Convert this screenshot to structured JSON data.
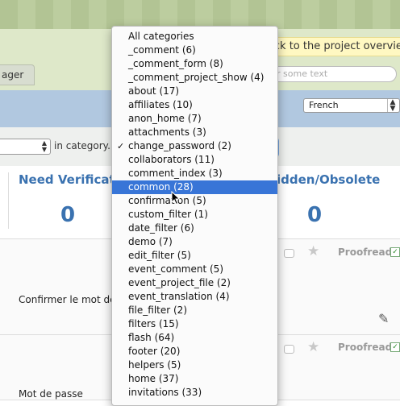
{
  "header": {
    "tab_label": "ager",
    "back_link": "Back to the project overview",
    "search_placeholder": "r some text"
  },
  "toolbar": {
    "language": "French",
    "in_category_label": "in category..."
  },
  "stats": {
    "need_verification_title": "Need Verification",
    "need_verification_count": "0",
    "hidden_title": "idden/Obsolete",
    "hidden_count": "0"
  },
  "rows": [
    {
      "text": "Confirmer le mot de",
      "status": "Proofread"
    },
    {
      "text": "Mot de passe",
      "status": "Proofread"
    }
  ],
  "category_dropdown": {
    "items": [
      "All categories",
      "_comment (6)",
      "_comment_form (8)",
      "_comment_project_show (4)",
      "about (17)",
      "affiliates (10)",
      "anon_home (7)",
      "attachments (3)",
      "change_password (2)",
      "collaborators (11)",
      "comment_index (3)",
      "common (28)",
      "confirmation (5)",
      "custom_filter (1)",
      "date_filter (6)",
      "demo (7)",
      "edit_filter (5)",
      "event_comment (5)",
      "event_project_file (2)",
      "event_translation (4)",
      "file_filter (2)",
      "filters (15)",
      "flash (64)",
      "footer (20)",
      "helpers (5)",
      "home (37)",
      "invitations (33)"
    ],
    "checked_item": "change_password (2)",
    "highlighted_item": "common (28)"
  },
  "colors": {
    "accent_blue": "#3a72b0",
    "selection_blue": "#3875d7",
    "header_green": "#dee8c9",
    "toolbar_blue": "#b1c8e0"
  }
}
